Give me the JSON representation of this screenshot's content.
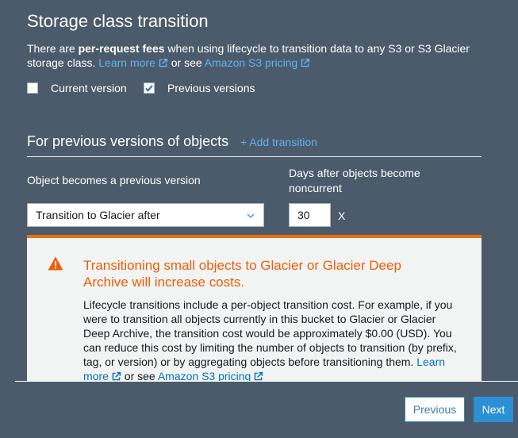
{
  "section": {
    "title": "Storage class transition",
    "desc_prefix": "There are ",
    "desc_bold": "per-request fees",
    "desc_rest": " when using lifecycle to transition data to any S3 or S3 Glacier storage class. ",
    "learn_more": "Learn more",
    "or_see": " or see ",
    "pricing": "Amazon S3 pricing"
  },
  "checkboxes": [
    {
      "label": "Current version",
      "checked": false
    },
    {
      "label": "Previous versions",
      "checked": true
    }
  ],
  "subsection": {
    "title": "For previous versions of objects",
    "add_transition": "+ Add transition"
  },
  "form": {
    "transition_label": "Object becomes a previous version",
    "days_label": "Days after objects become noncurrent",
    "transition_value": "Transition to Glacier after",
    "days_value": "30",
    "unit": "X"
  },
  "alert": {
    "title": "Transitioning small objects to Glacier or Glacier Deep Archive will increase costs.",
    "body": "Lifecycle transitions include a per-object transition cost. For example, if you were to transition all objects currently in this bucket to Glacier or Glacier Deep Archive, the transition cost would be approximately $0.00 (USD). You can reduce this cost by limiting the number of objects to transition (by prefix, tag, or version) or by aggregating objects before transitioning them. ",
    "learn_more": "Learn more",
    "or_see": " or see ",
    "pricing": "Amazon S3 pricing"
  },
  "buttons": {
    "previous": "Previous",
    "next": "Next"
  },
  "colors": {
    "background": "#4c5b6b",
    "link": "#5fb3f0",
    "warning": "#eb5f07",
    "primary": "#2d8fd5"
  }
}
